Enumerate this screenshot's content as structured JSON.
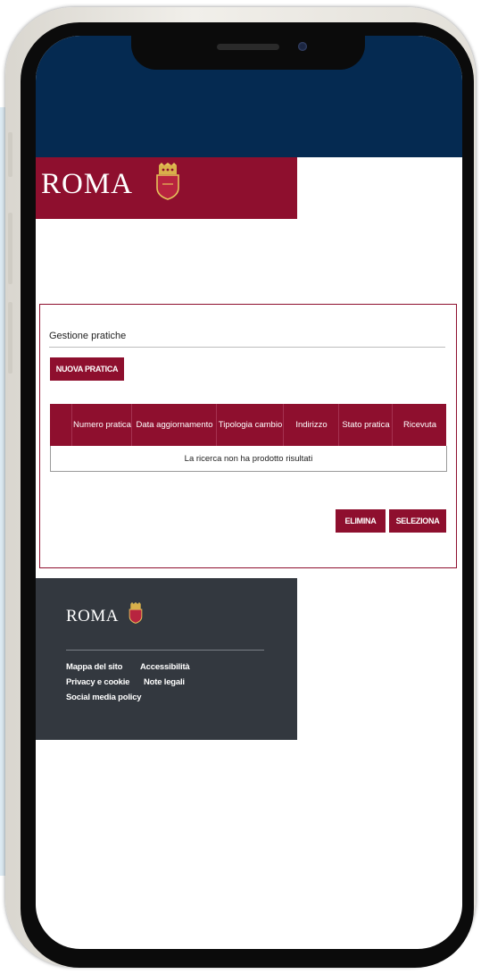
{
  "header": {
    "brand": "ROMA"
  },
  "panel": {
    "title": "Gestione pratiche",
    "new_button": "NUOVA PRATICA",
    "table": {
      "columns": [
        "",
        "Numero pratica",
        "Data aggiornamento",
        "Tipologia cambio",
        "Indirizzo",
        "Stato pratica",
        "Ricevuta"
      ],
      "empty_message": "La ricerca non ha prodotto risultati"
    },
    "delete_button": "ELIMINA",
    "select_button": "SELEZIONA"
  },
  "footer": {
    "brand": "ROMA",
    "links": [
      "Mappa del sito",
      "Accessibilità",
      "Privacy e cookie",
      "Note legali",
      "Social media policy"
    ]
  },
  "colors": {
    "brand_red": "#8e0f2e",
    "top_band": "#052a51",
    "footer": "#33383f"
  }
}
